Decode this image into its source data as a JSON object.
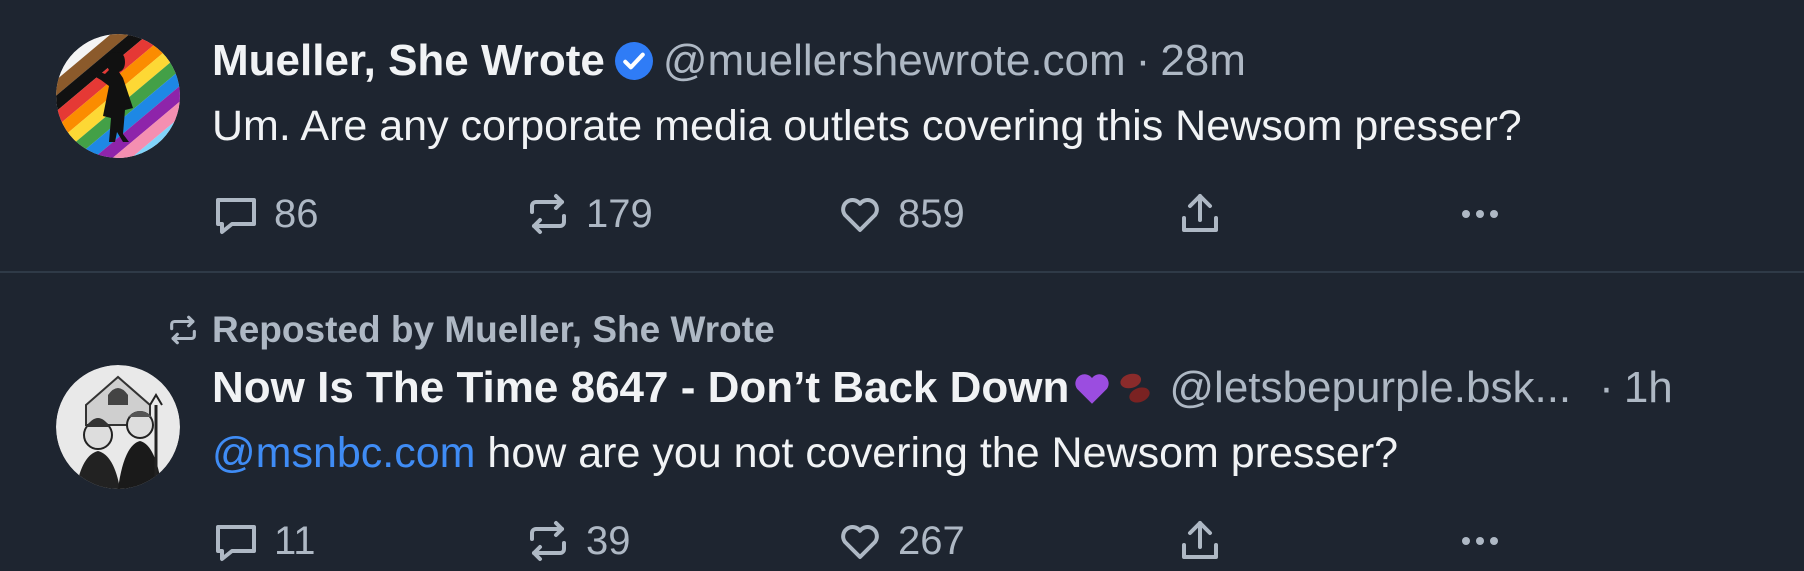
{
  "posts": [
    {
      "avatar_icon": "pride-silhouette-avatar",
      "author": "Mueller, She Wrote",
      "verified": true,
      "handle": "@muellershewrote.com",
      "separator": "·",
      "time": "28m",
      "text": "Um. Are any corporate media outlets covering this Newsom presser?",
      "counts": {
        "replies": "86",
        "reposts": "179",
        "likes": "859"
      }
    },
    {
      "repost_label": "Reposted by Mueller, She Wrote",
      "avatar_icon": "american-gothic-avatar",
      "author": "Now Is The Time 8647 - Don’t Back Down",
      "emoji": [
        "purple-heart-icon",
        "beans-icon"
      ],
      "handle": "@letsbepurple.bsk...",
      "separator": "·",
      "time": "1h",
      "mention": "@msnbc.com",
      "text": " how are you not covering the Newsom presser?",
      "counts": {
        "replies": "11",
        "reposts": "39",
        "likes": "267"
      }
    }
  ],
  "colors": {
    "background": "#1e2530",
    "text": "#f1f3f5",
    "muted": "#aeb8c4",
    "link": "#3f8cf5",
    "verified": "#2f7cf6",
    "divider": "#2f3a47"
  }
}
